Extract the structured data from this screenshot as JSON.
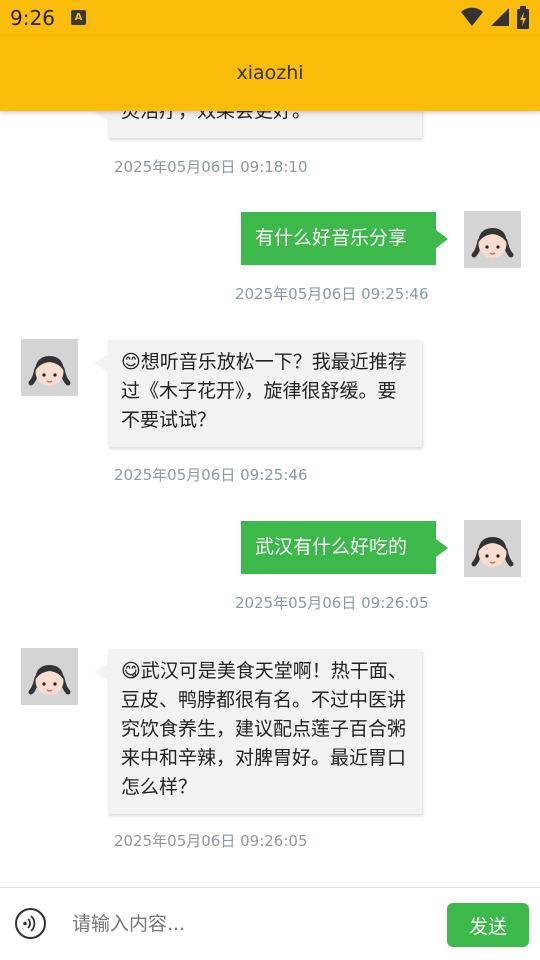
{
  "status_bar": {
    "time": "9:26",
    "notification_icon": "A"
  },
  "app": {
    "title": "xiaozhi"
  },
  "messages": [
    {
      "role": "assistant",
      "text": "灵活疗，效果会更好。",
      "timestamp": "2025年05月06日 09:18:10"
    },
    {
      "role": "user",
      "text": "有什么好音乐分享",
      "timestamp": "2025年05月06日 09:25:46"
    },
    {
      "role": "assistant",
      "text": "😊想听音乐放松一下？我最近推荐过《木子花开》，旋律很舒缓。要不要试试？",
      "timestamp": "2025年05月06日 09:25:46"
    },
    {
      "role": "user",
      "text": "武汉有什么好吃的",
      "timestamp": "2025年05月06日 09:26:05"
    },
    {
      "role": "assistant",
      "text": "😋武汉可是美食天堂啊！热干面、豆皮、鸭脖都很有名。不过中医讲究饮食养生，建议配点莲子百合粥来中和辛辣，对脾胃好。最近胃口怎么样？",
      "timestamp": "2025年05月06日 09:26:05"
    }
  ],
  "input": {
    "placeholder": "请输入内容...",
    "value": ""
  },
  "send_button": {
    "label": "发送"
  },
  "icons": {
    "avatar": "girl-avatar-icon",
    "voice": "voice-icon",
    "wifi": "wifi-icon",
    "signal": "signal-icon",
    "battery": "battery-icon"
  },
  "colors": {
    "app_bar": "#fbbd0a",
    "user_bubble": "#3cb94a",
    "assistant_bubble": "#f2f2f2",
    "timestamp": "#889aa2"
  }
}
